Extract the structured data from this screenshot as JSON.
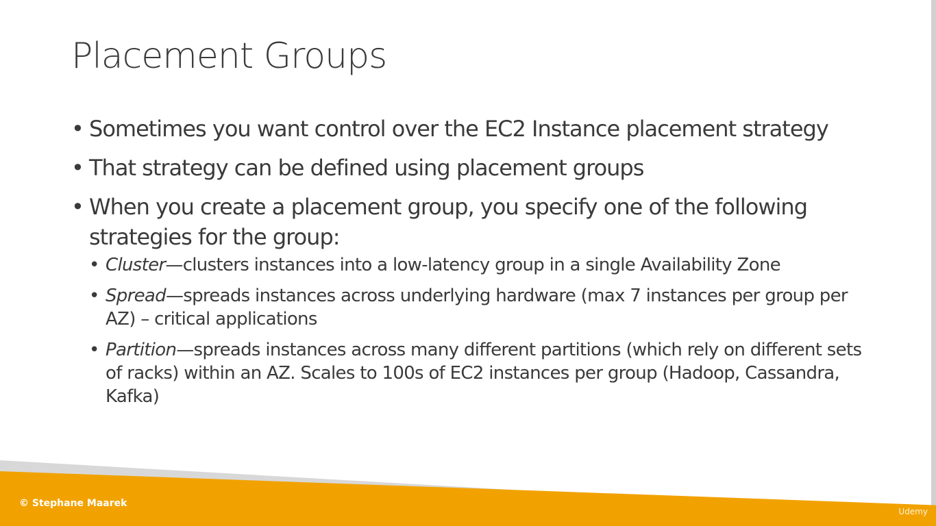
{
  "slide": {
    "title": "Placement Groups",
    "bullet_symbol": "•",
    "bullets": [
      {
        "text": "Sometimes you want control over the EC2 Instance placement strategy"
      },
      {
        "text": "That strategy can be defined using placement groups"
      },
      {
        "text": "When you create a placement group, you specify one of the following strategies for the group:"
      }
    ],
    "sub_bullets": [
      {
        "term": "Cluster",
        "text": "—clusters instances into a low-latency group in a single Availability Zone"
      },
      {
        "term": "Spread",
        "text": "—spreads instances across underlying hardware (max 7 instances per group per AZ) – critical applications"
      },
      {
        "term": "Partition",
        "text": "—spreads instances across many different partitions (which rely on different sets of racks) within an AZ. Scales to 100s of EC2 instances per group (Hadoop, Cassandra, Kafka)"
      }
    ]
  },
  "footer": {
    "copyright": "© Stephane Maarek",
    "watermark": "Udemy"
  },
  "colors": {
    "footer_band": "#f2a200",
    "footer_shadow": "#d8d8d8",
    "text": "#3a3a3a"
  }
}
